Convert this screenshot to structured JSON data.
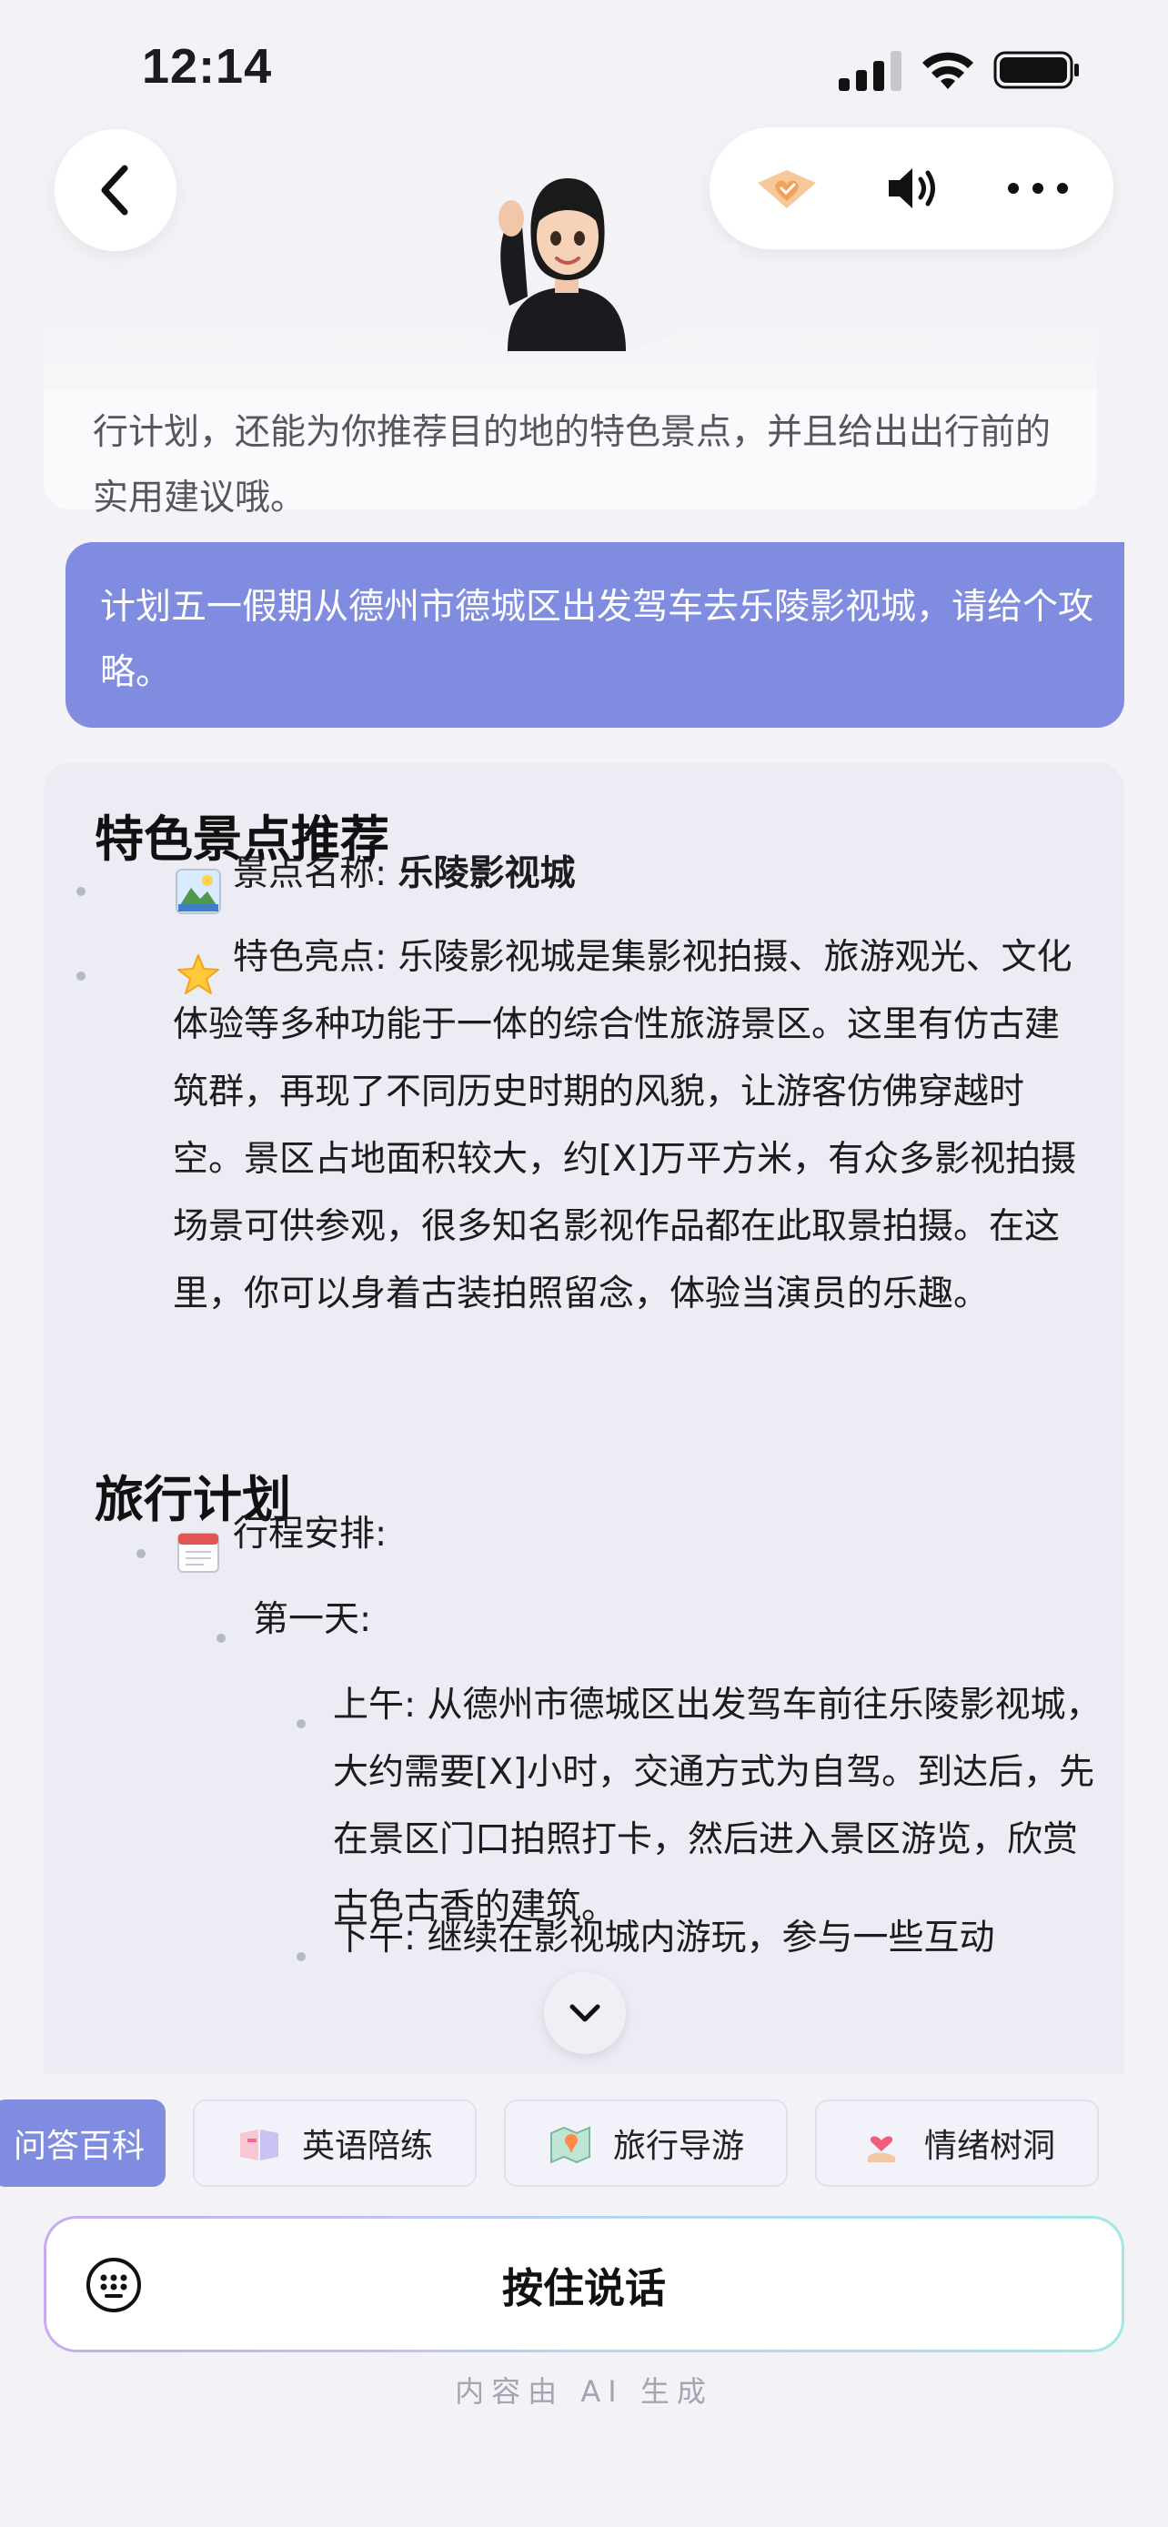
{
  "status_bar": {
    "time": "12:14"
  },
  "chat": {
    "intro_text": "行计划，还能为你推荐目的地的特色景点，并且给出出行前的实用建议哦。",
    "user_message": "计划五一假期从德州市德城区出发驾车去乐陵影视城，请给个攻略。",
    "answer": {
      "section1_title": "特色景点推荐",
      "spot_label": "景点名称: ",
      "spot_name": "乐陵影视城",
      "highlight_label": "特色亮点: ",
      "highlight_text": "乐陵影视城是集影视拍摄、旅游观光、文化体验等多种功能于一体的综合性旅游景区。这里有仿古建筑群，再现了不同历史时期的风貌，让游客仿佛穿越时空。景区占地面积较大，约[X]万平方米，有众多影视拍摄场景可供参观，很多知名影视作品都在此取景拍摄。在这里，你可以身着古装拍照留念，体验当演员的乐趣。",
      "section2_title": "旅行计划",
      "itinerary_label": "行程安排:",
      "day1_label": "第一天:",
      "morning_text": "上午: 从德州市德城区出发驾车前往乐陵影视城，大约需要[X]小时，交通方式为自驾。到达后，先在景区门口拍照打卡，然后进入景区游览，欣赏古色古香的建筑。",
      "afternoon_text": "下午: 继续在影视城内游玩，参与一些互动"
    }
  },
  "chips": [
    {
      "label": "问答百科",
      "icon": "encyclopedia-icon"
    },
    {
      "label": "英语陪练",
      "icon": "english-book-icon"
    },
    {
      "label": "旅行导游",
      "icon": "travel-map-icon"
    },
    {
      "label": "情绪树洞",
      "icon": "heart-hand-icon"
    }
  ],
  "voice_input": {
    "label": "按住说话"
  },
  "footer": {
    "ai_note": "内容由 AI 生成"
  },
  "colors": {
    "accent": "#7f8cdf",
    "background": "#f3f3f7",
    "card": "#ececf4"
  }
}
